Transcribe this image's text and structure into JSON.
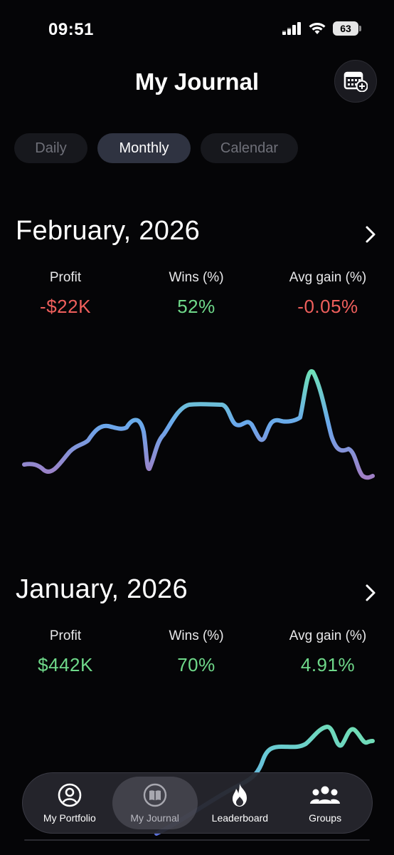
{
  "status_bar": {
    "time": "09:51",
    "battery": "63"
  },
  "header": {
    "title": "My Journal",
    "calendar_button_icon": "calendar-plus-icon"
  },
  "tabs": [
    {
      "label": "Daily",
      "active": false
    },
    {
      "label": "Monthly",
      "active": true
    },
    {
      "label": "Calendar",
      "active": false
    }
  ],
  "months": [
    {
      "title": "February, 2026",
      "stats": [
        {
          "label": "Profit",
          "value": "-$22K",
          "sentiment": "negative"
        },
        {
          "label": "Wins (%)",
          "value": "52%",
          "sentiment": "positive"
        },
        {
          "label": "Avg gain (%)",
          "value": "-0.05%",
          "sentiment": "negative"
        }
      ]
    },
    {
      "title": "January, 2026",
      "stats": [
        {
          "label": "Profit",
          "value": "$442K",
          "sentiment": "positive"
        },
        {
          "label": "Wins (%)",
          "value": "70%",
          "sentiment": "positive"
        },
        {
          "label": "Avg gain (%)",
          "value": "4.91%",
          "sentiment": "positive"
        }
      ]
    }
  ],
  "nav": [
    {
      "label": "My Portfolio",
      "icon": "person-circle-icon",
      "active": false
    },
    {
      "label": "My Journal",
      "icon": "book-icon",
      "active": true
    },
    {
      "label": "Leaderboard",
      "icon": "flame-icon",
      "active": false
    },
    {
      "label": "Groups",
      "icon": "people-icon",
      "active": false
    }
  ],
  "colors": {
    "positive": "#6fd98a",
    "negative": "#ef5f5c",
    "line_gradient": [
      "#9b7fc6",
      "#6aa8ec",
      "#6fe0b8"
    ]
  }
}
